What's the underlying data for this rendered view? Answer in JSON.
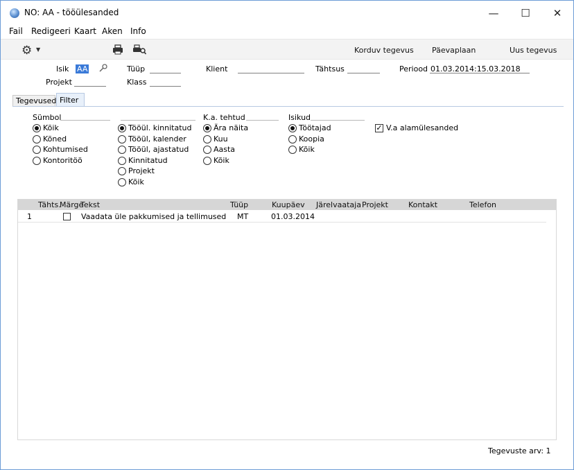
{
  "window": {
    "title": "NO: AA - tööülesanded",
    "controls": {
      "minimize": "—",
      "maximize": "☐",
      "close": "✕"
    }
  },
  "menu": [
    "Fail",
    "Redigeeri",
    "Kaart",
    "Aken",
    "Info"
  ],
  "toolbar": {
    "buttons": [
      "Korduv tegevus",
      "Päevaplaan",
      "Uus tegevus"
    ],
    "icons": [
      "gear-icon",
      "print-icon",
      "print-preview-icon"
    ]
  },
  "header_fields": {
    "isik": {
      "label": "Isik",
      "value": "AA"
    },
    "projekt": {
      "label": "Projekt",
      "value": ""
    },
    "tyyp": {
      "label": "Tüüp",
      "value": ""
    },
    "klass": {
      "label": "Klass",
      "value": ""
    },
    "klient": {
      "label": "Klient",
      "value": ""
    },
    "tahtsus": {
      "label": "Tähtsus",
      "value": ""
    },
    "periood": {
      "label": "Periood",
      "value": "01.03.2014:15.03.2018"
    }
  },
  "tabs": [
    {
      "label": "Tegevused",
      "active": false
    },
    {
      "label": "Filter",
      "active": true
    }
  ],
  "filter": {
    "symbol": {
      "title": "Sümbol",
      "options": [
        "Kõik",
        "Kõned",
        "Kohtumised",
        "Kontoritöö"
      ],
      "selected": 0
    },
    "tooul": {
      "title": "",
      "options": [
        "Tööül. kinnitatud",
        "Tööül, kalender",
        "Tööül, ajastatud",
        "Kinnitatud",
        "Projekt",
        "Kõik"
      ],
      "selected": 0
    },
    "ka_tehtud": {
      "title": "K.a. tehtud",
      "options": [
        "Ära näita",
        "Kuu",
        "Aasta",
        "Kõik"
      ],
      "selected": 0
    },
    "isikud": {
      "title": "Isikud",
      "options": [
        "Töötajad",
        "Koopia",
        "Kõik"
      ],
      "selected": 0
    },
    "checkbox": {
      "label": "V.a alamülesanded",
      "checked": true
    }
  },
  "grid": {
    "columns": [
      "Tähts.",
      "Märge",
      "Tekst",
      "Tüüp",
      "Kuupäev",
      "Järelvaataja",
      "Projekt",
      "Kontakt",
      "Telefon"
    ],
    "rows": [
      {
        "n": "1",
        "tahts": "",
        "marge": false,
        "tekst": "Vaadata üle pakkumised ja tellimused",
        "tyyp": "MT",
        "kuupaev": "01.03.2014",
        "jarelvaataja": "",
        "projekt": "",
        "kontakt": "",
        "telefon": ""
      }
    ]
  },
  "footer": {
    "count_label": "Tegevuste arv: 1"
  }
}
